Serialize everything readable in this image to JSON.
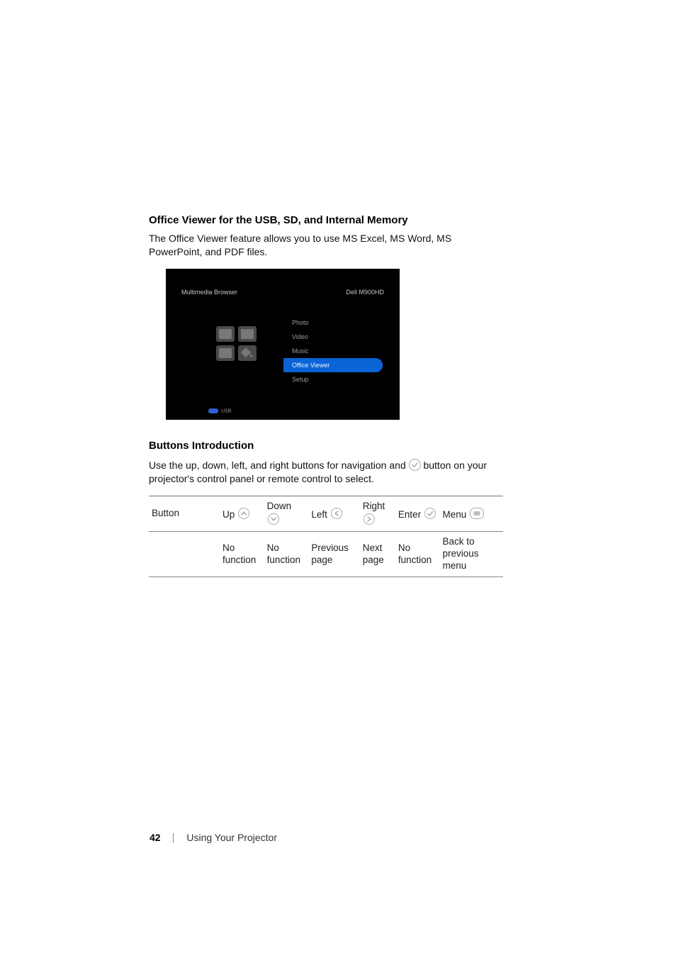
{
  "heading1": "Office Viewer for the USB, SD, and Internal Memory",
  "intro1": "The Office Viewer feature allows you to use MS Excel, MS Word, MS PowerPoint, and PDF files.",
  "screen": {
    "title": "Multimedia Browser",
    "model": "Dell M900HD",
    "menu": {
      "photo": "Photo",
      "video": "Video",
      "music": "Music",
      "office": "Office Viewer",
      "setup": "Setup"
    },
    "source": "USB"
  },
  "heading2": "Buttons Introduction",
  "intro2a": "Use the up, down, left, and right buttons for navigation and ",
  "intro2b": " button on your projector's control panel or remote control to select.",
  "table": {
    "header": {
      "button": "Button",
      "up": "Up",
      "down": "Down",
      "left": "Left",
      "right": "Right",
      "enter": "Enter",
      "menu": "Menu"
    },
    "row": {
      "c1": "",
      "up": "No function",
      "down": "No function",
      "left": "Previous page",
      "right": "Next page",
      "enter": "No function",
      "menu": "Back to previous menu"
    }
  },
  "footer": {
    "page": "42",
    "section": "Using Your Projector"
  }
}
